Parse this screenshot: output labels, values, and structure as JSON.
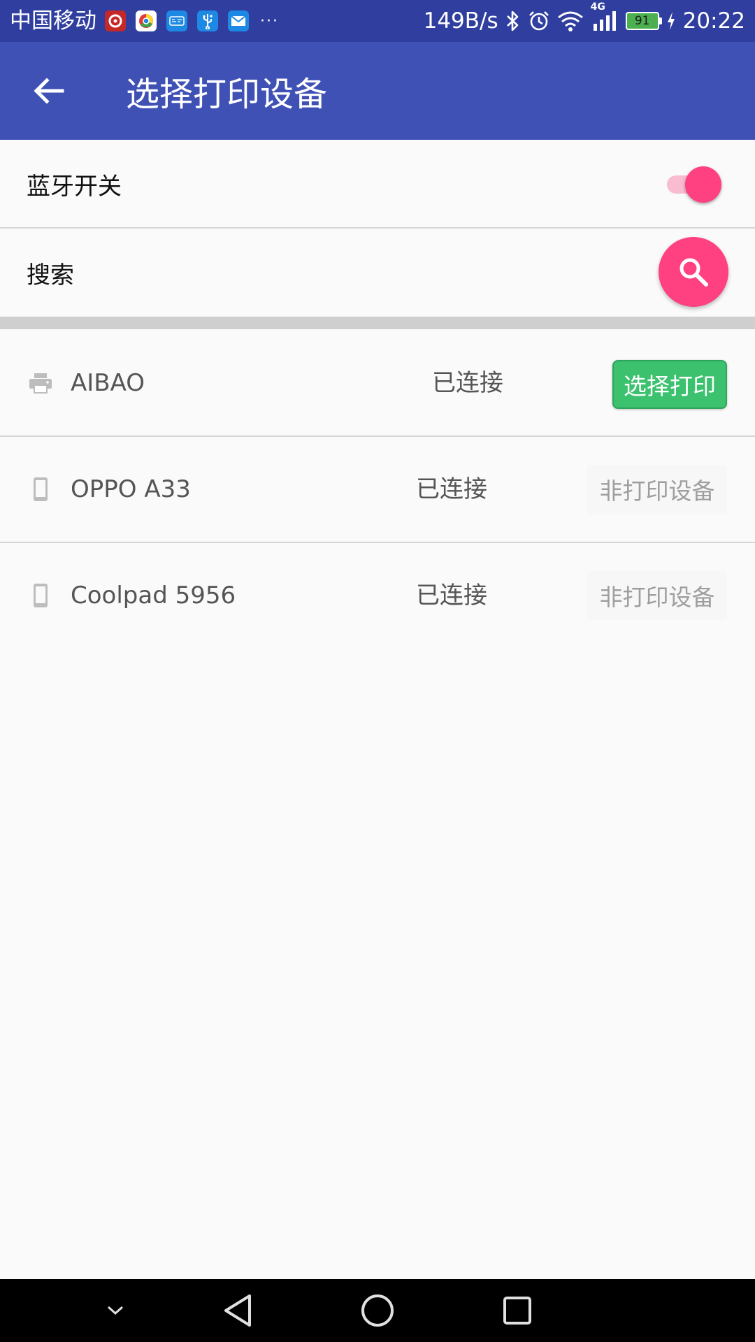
{
  "status_bar": {
    "carrier": "中国移动",
    "notification_icons": [
      "netease-music-icon",
      "browser-icon",
      "sms-app-icon",
      "usb-icon",
      "mail-icon"
    ],
    "overflow": "···",
    "net_speed": "149B/s",
    "network_type": "4G",
    "battery_level": "91",
    "time": "20:22"
  },
  "app_bar": {
    "title": "选择打印设备"
  },
  "bluetooth": {
    "label": "蓝牙开关",
    "enabled": true
  },
  "search": {
    "label": "搜索"
  },
  "devices": [
    {
      "name": "AIBAO",
      "icon": "printer-icon",
      "status": "已连接",
      "action": "选择打印",
      "is_printer": true
    },
    {
      "name": "OPPO A33",
      "icon": "phone-icon",
      "status": "已连接",
      "action": "非打印设备",
      "is_printer": false
    },
    {
      "name": "Coolpad 5956",
      "icon": "phone-icon",
      "status": "已连接",
      "action": "非打印设备",
      "is_printer": false
    }
  ],
  "colors": {
    "primary_dark": "#303f9f",
    "primary": "#3f51b5",
    "accent": "#ff4081",
    "print_button": "#3cc26f"
  }
}
